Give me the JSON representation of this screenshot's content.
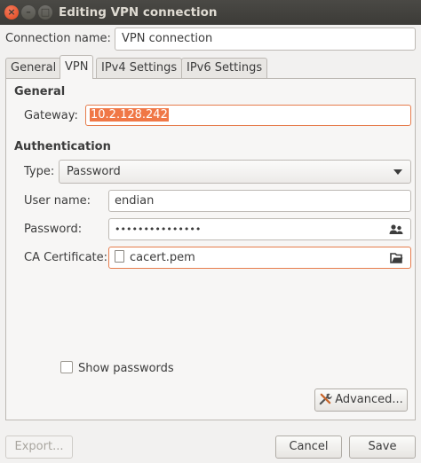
{
  "window": {
    "title": "Editing VPN connection",
    "close_glyph": "×",
    "minimize_glyph": "–",
    "maximize_glyph": "□"
  },
  "connection": {
    "label": "Connection name:",
    "value": "VPN connection"
  },
  "tabs": [
    {
      "label": "General",
      "active": false
    },
    {
      "label": "VPN",
      "active": true
    },
    {
      "label": "IPv4 Settings",
      "active": false
    },
    {
      "label": "IPv6 Settings",
      "active": false
    }
  ],
  "vpn": {
    "general_heading": "General",
    "gateway_label": "Gateway:",
    "gateway_value": "10.2.128.242",
    "auth_heading": "Authentication",
    "type_label": "Type:",
    "type_value": "Password",
    "username_label": "User name:",
    "username_value": "endian",
    "password_label": "Password:",
    "password_value": "•••••••••••••••",
    "ca_label": "CA Certificate:",
    "ca_value": "cacert.pem",
    "show_passwords_label": "Show passwords",
    "show_passwords_checked": false,
    "advanced_label": "Advanced..."
  },
  "footer": {
    "export_label": "Export...",
    "cancel_label": "Cancel",
    "save_label": "Save"
  },
  "colors": {
    "accent": "#f07746",
    "titlebar": "#3c3b37",
    "close_button": "#e1481e"
  }
}
